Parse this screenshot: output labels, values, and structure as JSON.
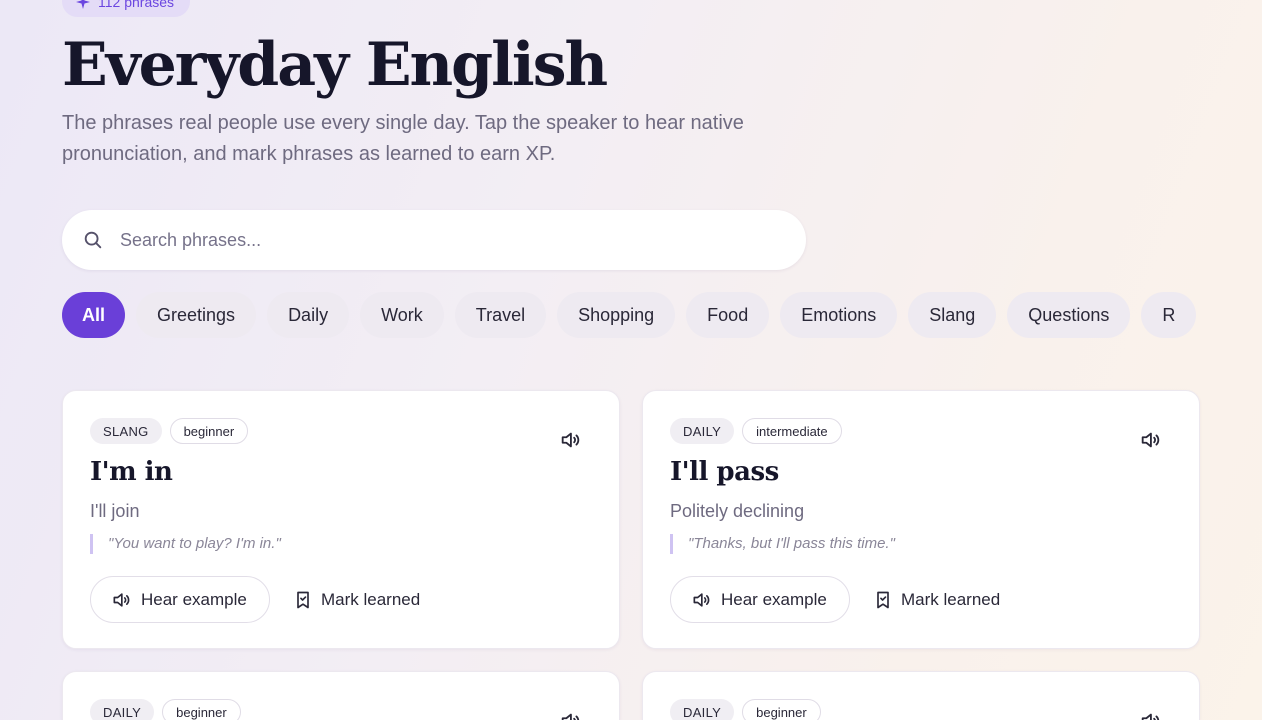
{
  "header": {
    "count_badge": "112 phrases",
    "title": "Everyday English",
    "subtitle": "The phrases real people use every single day. Tap the speaker to hear native pronunciation, and mark phrases as learned to earn XP."
  },
  "search": {
    "placeholder": "Search phrases..."
  },
  "filters": [
    "All",
    "Greetings",
    "Daily",
    "Work",
    "Travel",
    "Shopping",
    "Food",
    "Emotions",
    "Slang",
    "Questions",
    "R"
  ],
  "cards": [
    {
      "category": "SLANG",
      "level": "beginner",
      "phrase": "I'm in",
      "meaning": "I'll join",
      "example": "\"You want to play? I'm in.\"",
      "hear_label": "Hear example",
      "mark_label": "Mark learned"
    },
    {
      "category": "DAILY",
      "level": "intermediate",
      "phrase": "I'll pass",
      "meaning": "Politely declining",
      "example": "\"Thanks, but I'll pass this time.\"",
      "hear_label": "Hear example",
      "mark_label": "Mark learned"
    },
    {
      "category": "DAILY",
      "level": "beginner"
    },
    {
      "category": "DAILY",
      "level": "beginner"
    }
  ],
  "colors": {
    "accent": "#6a3fd8",
    "badge_bg": "#e4dcf7",
    "quote_bar": "#cfc3f2"
  },
  "icons": {
    "badge": "sparkle-icon",
    "search": "search-icon",
    "speaker": "speaker-icon",
    "bookmark": "bookmark-icon"
  }
}
